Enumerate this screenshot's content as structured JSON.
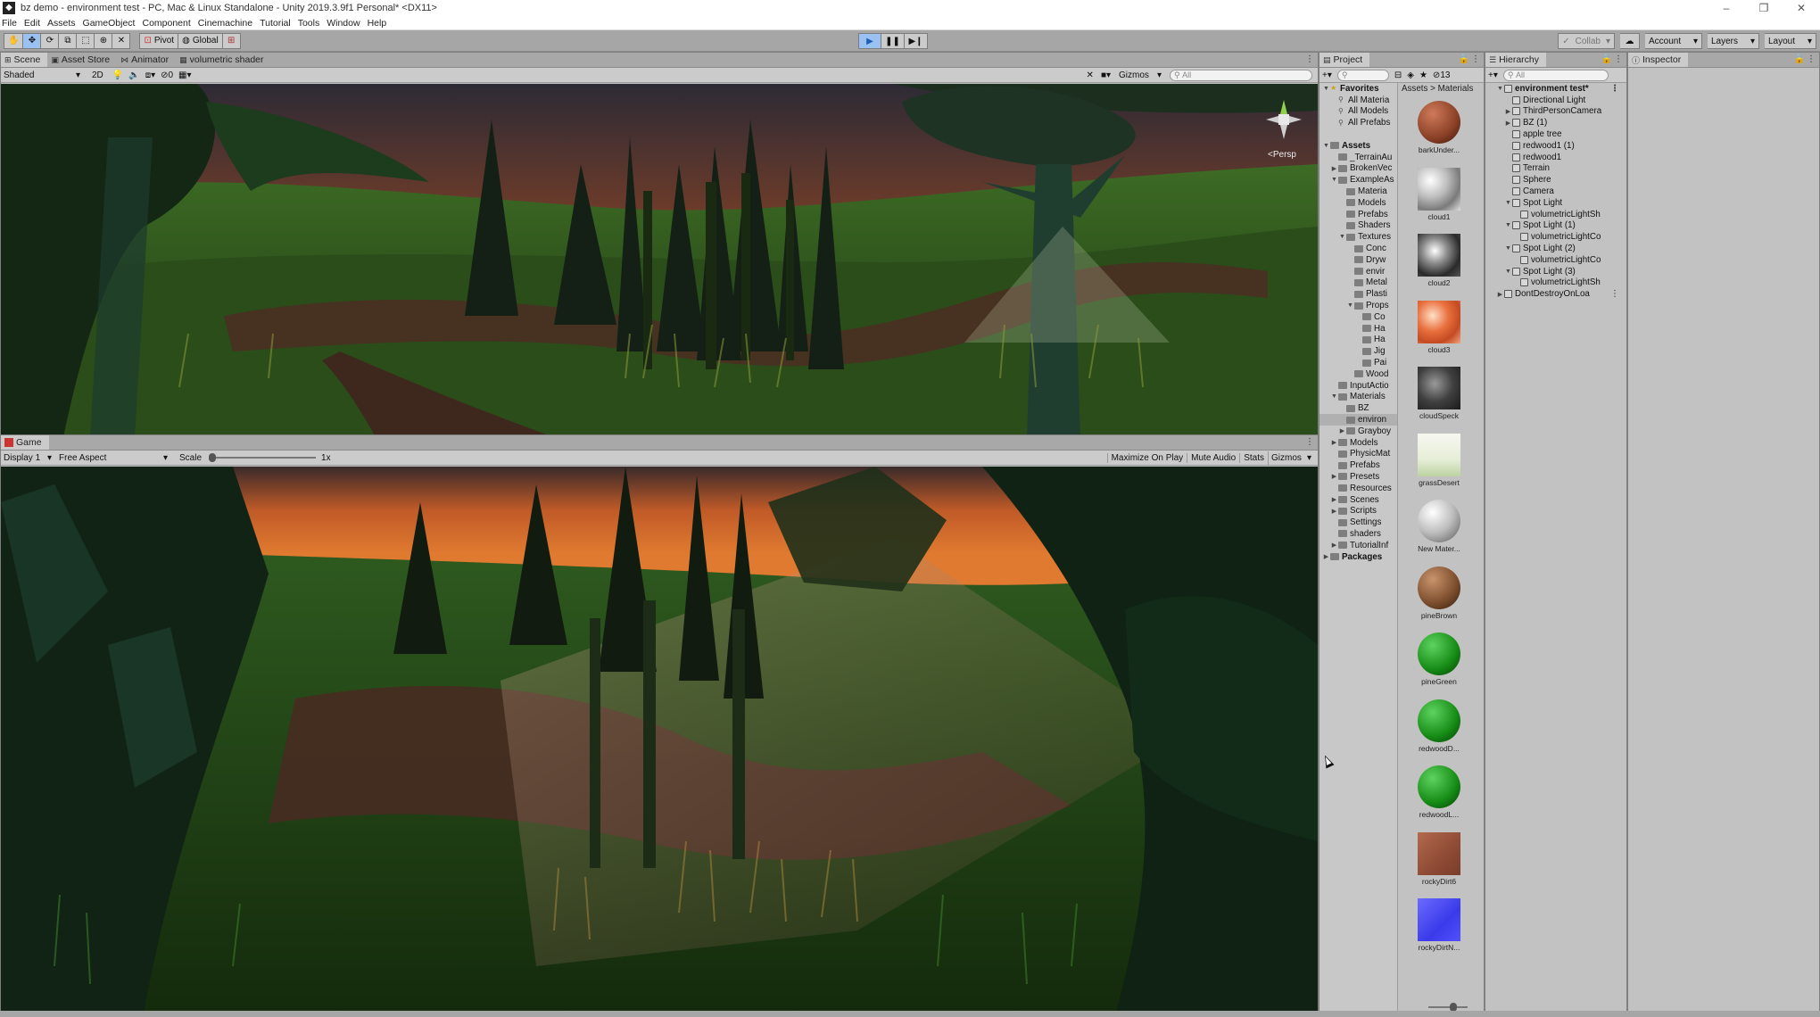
{
  "window": {
    "title": "bz demo - environment test - PC, Mac & Linux Standalone - Unity 2019.3.9f1 Personal* <DX11>",
    "controls": [
      "–",
      "❐",
      "✕"
    ]
  },
  "menu": [
    "File",
    "Edit",
    "Assets",
    "GameObject",
    "Component",
    "Cinemachine",
    "Tutorial",
    "Tools",
    "Window",
    "Help"
  ],
  "toolbar": {
    "pivot": "Pivot",
    "global": "Global",
    "collab": "Collab",
    "account": "Account",
    "layers": "Layers",
    "layout": "Layout"
  },
  "scene": {
    "tabs": [
      "Scene",
      "Asset Store",
      "Animator",
      "volumetric shader"
    ],
    "shading_mode": "Shaded",
    "mode_2d": "2D",
    "gizmos": "Gizmos",
    "search_placeholder": "All",
    "persp_label": "<Persp",
    "hidden_count": "0"
  },
  "game": {
    "tab": "Game",
    "display": "Display 1",
    "aspect": "Free Aspect",
    "scale_label": "Scale",
    "scale_value": "1x",
    "scale_level": 0,
    "maximize": "Maximize On Play",
    "mute": "Mute Audio",
    "stats": "Stats",
    "gizmos": "Gizmos"
  },
  "project": {
    "tab": "Project",
    "search_placeholder": "",
    "hidden_count": "13",
    "breadcrumb": [
      "Assets",
      ">",
      "Materials"
    ],
    "tree": [
      {
        "label": "Favorites",
        "depth": 0,
        "arrow": "▼",
        "icon": "star",
        "bold": true
      },
      {
        "label": "All Materia",
        "depth": 1,
        "arrow": "",
        "icon": "search"
      },
      {
        "label": "All Models",
        "depth": 1,
        "arrow": "",
        "icon": "search"
      },
      {
        "label": "All Prefabs",
        "depth": 1,
        "arrow": "",
        "icon": "search"
      },
      {
        "label": "",
        "depth": 0,
        "arrow": "",
        "icon": "none"
      },
      {
        "label": "Assets",
        "depth": 0,
        "arrow": "▼",
        "icon": "folder",
        "bold": true
      },
      {
        "label": "_TerrainAu",
        "depth": 1,
        "arrow": "",
        "icon": "folder"
      },
      {
        "label": "BrokenVec",
        "depth": 1,
        "arrow": "▶",
        "icon": "folder"
      },
      {
        "label": "ExampleAs",
        "depth": 1,
        "arrow": "▼",
        "icon": "folder"
      },
      {
        "label": "Materia",
        "depth": 2,
        "arrow": "",
        "icon": "folder"
      },
      {
        "label": "Models",
        "depth": 2,
        "arrow": "",
        "icon": "folder"
      },
      {
        "label": "Prefabs",
        "depth": 2,
        "arrow": "",
        "icon": "folder"
      },
      {
        "label": "Shaders",
        "depth": 2,
        "arrow": "",
        "icon": "folder"
      },
      {
        "label": "Textures",
        "depth": 2,
        "arrow": "▼",
        "icon": "folder"
      },
      {
        "label": "Conc",
        "depth": 3,
        "arrow": "",
        "icon": "folder"
      },
      {
        "label": "Dryw",
        "depth": 3,
        "arrow": "",
        "icon": "folder"
      },
      {
        "label": "envir",
        "depth": 3,
        "arrow": "",
        "icon": "folder"
      },
      {
        "label": "Metal",
        "depth": 3,
        "arrow": "",
        "icon": "folder"
      },
      {
        "label": "Plasti",
        "depth": 3,
        "arrow": "",
        "icon": "folder"
      },
      {
        "label": "Props",
        "depth": 3,
        "arrow": "▼",
        "icon": "folder"
      },
      {
        "label": "Co",
        "depth": 4,
        "arrow": "",
        "icon": "folder"
      },
      {
        "label": "Ha",
        "depth": 4,
        "arrow": "",
        "icon": "folder"
      },
      {
        "label": "Ha",
        "depth": 4,
        "arrow": "",
        "icon": "folder"
      },
      {
        "label": "Jig",
        "depth": 4,
        "arrow": "",
        "icon": "folder"
      },
      {
        "label": "Pai",
        "depth": 4,
        "arrow": "",
        "icon": "folder"
      },
      {
        "label": "Wood",
        "depth": 3,
        "arrow": "",
        "icon": "folder"
      },
      {
        "label": "InputActio",
        "depth": 1,
        "arrow": "",
        "icon": "folder"
      },
      {
        "label": "Materials",
        "depth": 1,
        "arrow": "▼",
        "icon": "folder"
      },
      {
        "label": "BZ",
        "depth": 2,
        "arrow": "",
        "icon": "folder"
      },
      {
        "label": "environ",
        "depth": 2,
        "arrow": "",
        "icon": "folder",
        "selected": true
      },
      {
        "label": "Grayboy",
        "depth": 2,
        "arrow": "▶",
        "icon": "folder"
      },
      {
        "label": "Models",
        "depth": 1,
        "arrow": "▶",
        "icon": "folder"
      },
      {
        "label": "PhysicMat",
        "depth": 1,
        "arrow": "",
        "icon": "folder"
      },
      {
        "label": "Prefabs",
        "depth": 1,
        "arrow": "",
        "icon": "folder"
      },
      {
        "label": "Presets",
        "depth": 1,
        "arrow": "▶",
        "icon": "folder"
      },
      {
        "label": "Resources",
        "depth": 1,
        "arrow": "",
        "icon": "folder"
      },
      {
        "label": "Scenes",
        "depth": 1,
        "arrow": "▶",
        "icon": "folder"
      },
      {
        "label": "Scripts",
        "depth": 1,
        "arrow": "▶",
        "icon": "folder"
      },
      {
        "label": "Settings",
        "depth": 1,
        "arrow": "",
        "icon": "folder"
      },
      {
        "label": "shaders",
        "depth": 1,
        "arrow": "",
        "icon": "folder"
      },
      {
        "label": "TutorialInf",
        "depth": 1,
        "arrow": "▶",
        "icon": "folder"
      },
      {
        "label": "Packages",
        "depth": 0,
        "arrow": "▶",
        "icon": "folder",
        "bold": true
      }
    ],
    "assets": [
      {
        "name": "barkUnder...",
        "fill": "radial-gradient(circle at 35% 30%, #d07a5a, #8a4026 60%, #3a150a)",
        "sphere": true
      },
      {
        "name": "cloud1",
        "fill": "radial-gradient(circle at 30% 30%, #ffffff, #bdbdbd 40%, #7a7a7a 70%, #e0e0e0)",
        "sphere": false
      },
      {
        "name": "cloud2",
        "fill": "radial-gradient(circle at 40% 40%, #ffffff, #8a8a8a 35%, #2a2a2a 70%, #555555)",
        "sphere": false
      },
      {
        "name": "cloud3",
        "fill": "radial-gradient(circle at 35% 35%, #ffe0c8, #e9703e 40%, #c44a22 70%, #f3a37c)",
        "sphere": false
      },
      {
        "name": "cloudSpeck",
        "fill": "radial-gradient(circle at 40% 40%, #9a9a9a, #404040 50%, #1a1a1a)",
        "sphere": false
      },
      {
        "name": "grassDesert",
        "fill": "linear-gradient(180deg, #f7f7f0, #e6eed8 60%, #bdd3a1)",
        "sphere": false
      },
      {
        "name": "New Mater...",
        "fill": "radial-gradient(circle at 35% 30%, #ffffff, #bdbdbd 50%, #575757)",
        "sphere": true
      },
      {
        "name": "pineBrown",
        "fill": "radial-gradient(circle at 35% 30%, #c9936c, #7a4c2c 60%, #2e1a0c)",
        "sphere": true
      },
      {
        "name": "pineGreen",
        "fill": "radial-gradient(circle at 35% 30%, #5fd35f, #158a15 60%, #053d05)",
        "sphere": true
      },
      {
        "name": "redwoodD...",
        "fill": "radial-gradient(circle at 35% 30%, #5fd35f, #158a15 60%, #053d05)",
        "sphere": true
      },
      {
        "name": "redwoodL...",
        "fill": "radial-gradient(circle at 35% 30%, #5fd35f, #158a15 60%, #053d05)",
        "sphere": true
      },
      {
        "name": "rockyDirt6",
        "fill": "linear-gradient(135deg, #b36a4f, #8e4a34 60%, #7a3d2a)",
        "sphere": false
      },
      {
        "name": "rockyDirtN...",
        "fill": "linear-gradient(135deg, #6b6bff, #3a3aea 60%, #5151ff)",
        "sphere": false
      }
    ]
  },
  "hierarchy": {
    "tab": "Hierarchy",
    "search_placeholder": "All",
    "rows": [
      {
        "label": "environment test*",
        "depth": 0,
        "arrow": "▼",
        "bold": true,
        "kebab": true
      },
      {
        "label": "Directional Light",
        "depth": 1,
        "arrow": ""
      },
      {
        "label": "ThirdPersonCamera",
        "depth": 1,
        "arrow": "▶"
      },
      {
        "label": "BZ (1)",
        "depth": 1,
        "arrow": "▶"
      },
      {
        "label": "apple tree",
        "depth": 1,
        "arrow": ""
      },
      {
        "label": "redwood1 (1)",
        "depth": 1,
        "arrow": ""
      },
      {
        "label": "redwood1",
        "depth": 1,
        "arrow": ""
      },
      {
        "label": "Terrain",
        "depth": 1,
        "arrow": ""
      },
      {
        "label": "Sphere",
        "depth": 1,
        "arrow": ""
      },
      {
        "label": "Camera",
        "depth": 1,
        "arrow": ""
      },
      {
        "label": "Spot Light",
        "depth": 1,
        "arrow": "▼"
      },
      {
        "label": "volumetricLightSh",
        "depth": 2,
        "arrow": ""
      },
      {
        "label": "Spot Light (1)",
        "depth": 1,
        "arrow": "▼"
      },
      {
        "label": "volumetricLightCo",
        "depth": 2,
        "arrow": ""
      },
      {
        "label": "Spot Light (2)",
        "depth": 1,
        "arrow": "▼"
      },
      {
        "label": "volumetricLightCo",
        "depth": 2,
        "arrow": ""
      },
      {
        "label": "Spot Light (3)",
        "depth": 1,
        "arrow": "▼"
      },
      {
        "label": "volumetricLightSh",
        "depth": 2,
        "arrow": ""
      },
      {
        "label": "DontDestroyOnLoa",
        "depth": 0,
        "arrow": "▶",
        "kebab": true
      }
    ]
  },
  "inspector": {
    "tab": "Inspector"
  }
}
